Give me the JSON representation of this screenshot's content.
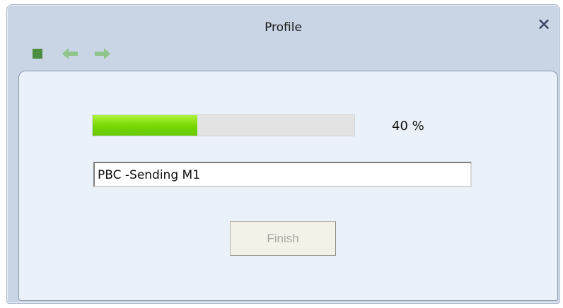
{
  "window": {
    "title": "Profile",
    "close_label": "✕"
  },
  "toolbar": {
    "items": [
      {
        "icon": "stop-icon"
      },
      {
        "icon": "back-arrow-icon"
      },
      {
        "icon": "forward-arrow-icon"
      }
    ]
  },
  "progress": {
    "percent": 40,
    "label": "40 %"
  },
  "status": {
    "text": "PBC -Sending M1"
  },
  "actions": {
    "finish_label": "Finish",
    "finish_enabled": false
  },
  "colors": {
    "progress_green": "#74d600",
    "title_bg": "#c9d4e4",
    "panel_bg": "#eaf1f8"
  }
}
